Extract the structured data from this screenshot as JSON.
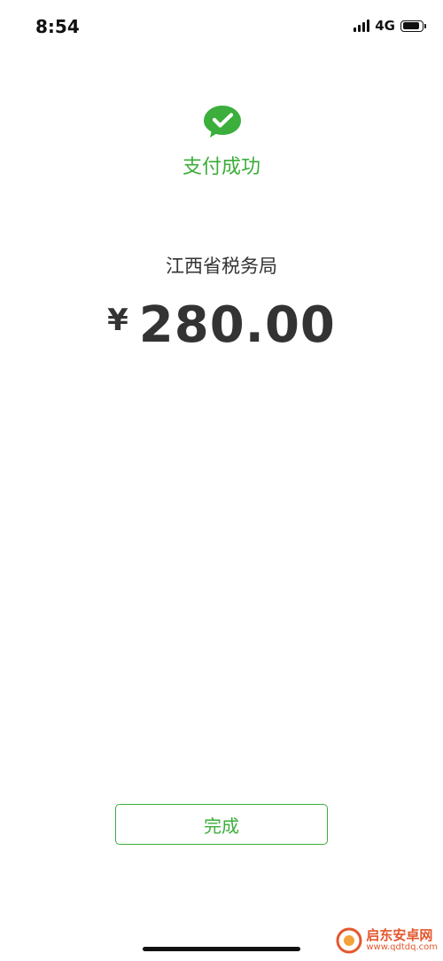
{
  "status_bar": {
    "time": "8:54",
    "network": "4G",
    "signal_bars": 4,
    "battery_level": 0.9
  },
  "result": {
    "icon": "wechat-pay-success-icon",
    "title": "支付成功",
    "payee": "江西省税务局",
    "currency_symbol": "¥",
    "amount": "280.00"
  },
  "actions": {
    "done_label": "完成"
  },
  "watermark": {
    "title": "启东安卓网",
    "url": "www.qdtdq.com"
  },
  "colors": {
    "accent": "#3bae3b",
    "text": "#333333",
    "watermark": "#e4572e"
  }
}
